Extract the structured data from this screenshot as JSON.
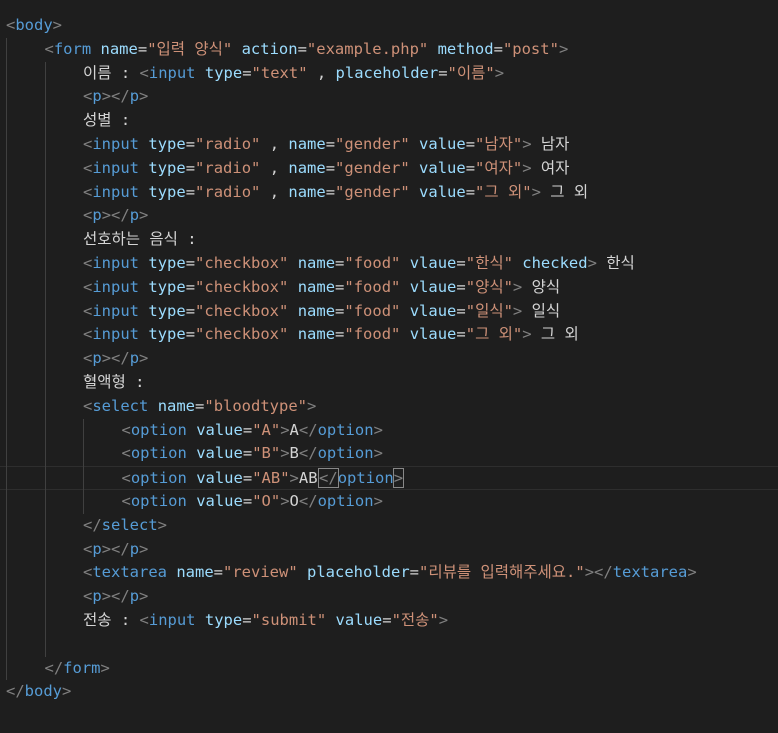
{
  "editor": {
    "language": "html",
    "colors": {
      "background": "#1e1e1e",
      "tag": "#569cd6",
      "punctuation": "#808080",
      "attribute": "#9cdcfe",
      "string": "#ce9178",
      "text": "#d4d4d4"
    },
    "current_line": 19,
    "lines": [
      {
        "indent": 0,
        "tokens": [
          [
            "p",
            "<"
          ],
          [
            "tag",
            "body"
          ],
          [
            "p",
            ">"
          ]
        ]
      },
      {
        "indent": 1,
        "tokens": [
          [
            "p",
            "<"
          ],
          [
            "tag",
            "form"
          ],
          [
            "t",
            " "
          ],
          [
            "attr",
            "name"
          ],
          [
            "e",
            "="
          ],
          [
            "str",
            "\"입력 양식\""
          ],
          [
            "t",
            " "
          ],
          [
            "attr",
            "action"
          ],
          [
            "e",
            "="
          ],
          [
            "str",
            "\"example.php\""
          ],
          [
            "t",
            " "
          ],
          [
            "attr",
            "method"
          ],
          [
            "e",
            "="
          ],
          [
            "str",
            "\"post\""
          ],
          [
            "p",
            ">"
          ]
        ]
      },
      {
        "indent": 2,
        "tokens": [
          [
            "t",
            "이름 : "
          ],
          [
            "p",
            "<"
          ],
          [
            "tag",
            "input"
          ],
          [
            "t",
            " "
          ],
          [
            "attr",
            "type"
          ],
          [
            "e",
            "="
          ],
          [
            "str",
            "\"text\""
          ],
          [
            "t",
            " , "
          ],
          [
            "attr",
            "placeholder"
          ],
          [
            "e",
            "="
          ],
          [
            "str",
            "\"이름\""
          ],
          [
            "p",
            ">"
          ]
        ]
      },
      {
        "indent": 2,
        "tokens": [
          [
            "p",
            "<"
          ],
          [
            "tag",
            "p"
          ],
          [
            "p",
            "></"
          ],
          [
            "tag",
            "p"
          ],
          [
            "p",
            ">"
          ]
        ]
      },
      {
        "indent": 2,
        "tokens": [
          [
            "t",
            "성별 :"
          ]
        ]
      },
      {
        "indent": 2,
        "tokens": [
          [
            "p",
            "<"
          ],
          [
            "tag",
            "input"
          ],
          [
            "t",
            " "
          ],
          [
            "attr",
            "type"
          ],
          [
            "e",
            "="
          ],
          [
            "str",
            "\"radio\""
          ],
          [
            "t",
            " , "
          ],
          [
            "attr",
            "name"
          ],
          [
            "e",
            "="
          ],
          [
            "str",
            "\"gender\""
          ],
          [
            "t",
            " "
          ],
          [
            "attr",
            "value"
          ],
          [
            "e",
            "="
          ],
          [
            "str",
            "\"남자\""
          ],
          [
            "p",
            ">"
          ],
          [
            "t",
            " 남자"
          ]
        ]
      },
      {
        "indent": 2,
        "tokens": [
          [
            "p",
            "<"
          ],
          [
            "tag",
            "input"
          ],
          [
            "t",
            " "
          ],
          [
            "attr",
            "type"
          ],
          [
            "e",
            "="
          ],
          [
            "str",
            "\"radio\""
          ],
          [
            "t",
            " , "
          ],
          [
            "attr",
            "name"
          ],
          [
            "e",
            "="
          ],
          [
            "str",
            "\"gender\""
          ],
          [
            "t",
            " "
          ],
          [
            "attr",
            "value"
          ],
          [
            "e",
            "="
          ],
          [
            "str",
            "\"여자\""
          ],
          [
            "p",
            ">"
          ],
          [
            "t",
            " 여자"
          ]
        ]
      },
      {
        "indent": 2,
        "tokens": [
          [
            "p",
            "<"
          ],
          [
            "tag",
            "input"
          ],
          [
            "t",
            " "
          ],
          [
            "attr",
            "type"
          ],
          [
            "e",
            "="
          ],
          [
            "str",
            "\"radio\""
          ],
          [
            "t",
            " , "
          ],
          [
            "attr",
            "name"
          ],
          [
            "e",
            "="
          ],
          [
            "str",
            "\"gender\""
          ],
          [
            "t",
            " "
          ],
          [
            "attr",
            "value"
          ],
          [
            "e",
            "="
          ],
          [
            "str",
            "\"그 외\""
          ],
          [
            "p",
            ">"
          ],
          [
            "t",
            " 그 외"
          ]
        ]
      },
      {
        "indent": 2,
        "tokens": [
          [
            "p",
            "<"
          ],
          [
            "tag",
            "p"
          ],
          [
            "p",
            "></"
          ],
          [
            "tag",
            "p"
          ],
          [
            "p",
            ">"
          ]
        ]
      },
      {
        "indent": 2,
        "tokens": [
          [
            "t",
            "선호하는 음식 :"
          ]
        ]
      },
      {
        "indent": 2,
        "tokens": [
          [
            "p",
            "<"
          ],
          [
            "tag",
            "input"
          ],
          [
            "t",
            " "
          ],
          [
            "attr",
            "type"
          ],
          [
            "e",
            "="
          ],
          [
            "str",
            "\"checkbox\""
          ],
          [
            "t",
            " "
          ],
          [
            "attr",
            "name"
          ],
          [
            "e",
            "="
          ],
          [
            "str",
            "\"food\""
          ],
          [
            "t",
            " "
          ],
          [
            "attr",
            "vlaue"
          ],
          [
            "e",
            "="
          ],
          [
            "str",
            "\"한식\""
          ],
          [
            "t",
            " "
          ],
          [
            "attr",
            "checked"
          ],
          [
            "p",
            ">"
          ],
          [
            "t",
            " 한식"
          ]
        ]
      },
      {
        "indent": 2,
        "tokens": [
          [
            "p",
            "<"
          ],
          [
            "tag",
            "input"
          ],
          [
            "t",
            " "
          ],
          [
            "attr",
            "type"
          ],
          [
            "e",
            "="
          ],
          [
            "str",
            "\"checkbox\""
          ],
          [
            "t",
            " "
          ],
          [
            "attr",
            "name"
          ],
          [
            "e",
            "="
          ],
          [
            "str",
            "\"food\""
          ],
          [
            "t",
            " "
          ],
          [
            "attr",
            "vlaue"
          ],
          [
            "e",
            "="
          ],
          [
            "str",
            "\"양식\""
          ],
          [
            "p",
            ">"
          ],
          [
            "t",
            " 양식"
          ]
        ]
      },
      {
        "indent": 2,
        "tokens": [
          [
            "p",
            "<"
          ],
          [
            "tag",
            "input"
          ],
          [
            "t",
            " "
          ],
          [
            "attr",
            "type"
          ],
          [
            "e",
            "="
          ],
          [
            "str",
            "\"checkbox\""
          ],
          [
            "t",
            " "
          ],
          [
            "attr",
            "name"
          ],
          [
            "e",
            "="
          ],
          [
            "str",
            "\"food\""
          ],
          [
            "t",
            " "
          ],
          [
            "attr",
            "vlaue"
          ],
          [
            "e",
            "="
          ],
          [
            "str",
            "\"일식\""
          ],
          [
            "p",
            ">"
          ],
          [
            "t",
            " 일식"
          ]
        ]
      },
      {
        "indent": 2,
        "tokens": [
          [
            "p",
            "<"
          ],
          [
            "tag",
            "input"
          ],
          [
            "t",
            " "
          ],
          [
            "attr",
            "type"
          ],
          [
            "e",
            "="
          ],
          [
            "str",
            "\"checkbox\""
          ],
          [
            "t",
            " "
          ],
          [
            "attr",
            "name"
          ],
          [
            "e",
            "="
          ],
          [
            "str",
            "\"food\""
          ],
          [
            "t",
            " "
          ],
          [
            "attr",
            "vlaue"
          ],
          [
            "e",
            "="
          ],
          [
            "str",
            "\"그 외\""
          ],
          [
            "p",
            ">"
          ],
          [
            "t",
            " 그 외"
          ]
        ]
      },
      {
        "indent": 2,
        "tokens": [
          [
            "p",
            "<"
          ],
          [
            "tag",
            "p"
          ],
          [
            "p",
            "></"
          ],
          [
            "tag",
            "p"
          ],
          [
            "p",
            ">"
          ]
        ]
      },
      {
        "indent": 2,
        "tokens": [
          [
            "t",
            "혈액형 :"
          ]
        ]
      },
      {
        "indent": 2,
        "tokens": [
          [
            "p",
            "<"
          ],
          [
            "tag",
            "select"
          ],
          [
            "t",
            " "
          ],
          [
            "attr",
            "name"
          ],
          [
            "e",
            "="
          ],
          [
            "str",
            "\"bloodtype\""
          ],
          [
            "p",
            ">"
          ]
        ]
      },
      {
        "indent": 3,
        "tokens": [
          [
            "p",
            "<"
          ],
          [
            "tag",
            "option"
          ],
          [
            "t",
            " "
          ],
          [
            "attr",
            "value"
          ],
          [
            "e",
            "="
          ],
          [
            "str",
            "\"A\""
          ],
          [
            "p",
            ">"
          ],
          [
            "t",
            "A"
          ],
          [
            "p",
            "</"
          ],
          [
            "tag",
            "option"
          ],
          [
            "p",
            ">"
          ]
        ]
      },
      {
        "indent": 3,
        "tokens": [
          [
            "p",
            "<"
          ],
          [
            "tag",
            "option"
          ],
          [
            "t",
            " "
          ],
          [
            "attr",
            "value"
          ],
          [
            "e",
            "="
          ],
          [
            "str",
            "\"B\""
          ],
          [
            "p",
            ">"
          ],
          [
            "t",
            "B"
          ],
          [
            "p",
            "</"
          ],
          [
            "tag",
            "option"
          ],
          [
            "p",
            ">"
          ]
        ]
      },
      {
        "indent": 3,
        "tokens": [
          [
            "p",
            "<"
          ],
          [
            "tag",
            "option"
          ],
          [
            "t",
            " "
          ],
          [
            "attr",
            "value"
          ],
          [
            "e",
            "="
          ],
          [
            "str",
            "\"AB\""
          ],
          [
            "p",
            ">"
          ],
          [
            "t",
            "AB"
          ],
          [
            "cursor",
            ""
          ],
          [
            "pm",
            "</"
          ],
          [
            "tag",
            "option"
          ],
          [
            "pm",
            ">"
          ]
        ]
      },
      {
        "indent": 3,
        "tokens": [
          [
            "p",
            "<"
          ],
          [
            "tag",
            "option"
          ],
          [
            "t",
            " "
          ],
          [
            "attr",
            "value"
          ],
          [
            "e",
            "="
          ],
          [
            "str",
            "\"O\""
          ],
          [
            "p",
            ">"
          ],
          [
            "t",
            "O"
          ],
          [
            "p",
            "</"
          ],
          [
            "tag",
            "option"
          ],
          [
            "p",
            ">"
          ]
        ]
      },
      {
        "indent": 2,
        "tokens": [
          [
            "p",
            "</"
          ],
          [
            "tag",
            "select"
          ],
          [
            "p",
            ">"
          ]
        ]
      },
      {
        "indent": 2,
        "tokens": [
          [
            "p",
            "<"
          ],
          [
            "tag",
            "p"
          ],
          [
            "p",
            "></"
          ],
          [
            "tag",
            "p"
          ],
          [
            "p",
            ">"
          ]
        ]
      },
      {
        "indent": 2,
        "tokens": [
          [
            "p",
            "<"
          ],
          [
            "tag",
            "textarea"
          ],
          [
            "t",
            " "
          ],
          [
            "attr",
            "name"
          ],
          [
            "e",
            "="
          ],
          [
            "str",
            "\"review\""
          ],
          [
            "t",
            " "
          ],
          [
            "attr",
            "placeholder"
          ],
          [
            "e",
            "="
          ],
          [
            "str",
            "\"리뷰를 입력해주세요.\""
          ],
          [
            "p",
            "></"
          ],
          [
            "tag",
            "textarea"
          ],
          [
            "p",
            ">"
          ]
        ]
      },
      {
        "indent": 2,
        "tokens": [
          [
            "p",
            "<"
          ],
          [
            "tag",
            "p"
          ],
          [
            "p",
            "></"
          ],
          [
            "tag",
            "p"
          ],
          [
            "p",
            ">"
          ]
        ]
      },
      {
        "indent": 2,
        "tokens": [
          [
            "t",
            "전송 : "
          ],
          [
            "p",
            "<"
          ],
          [
            "tag",
            "input"
          ],
          [
            "t",
            " "
          ],
          [
            "attr",
            "type"
          ],
          [
            "e",
            "="
          ],
          [
            "str",
            "\"submit\""
          ],
          [
            "t",
            " "
          ],
          [
            "attr",
            "value"
          ],
          [
            "e",
            "="
          ],
          [
            "str",
            "\"전송\""
          ],
          [
            "p",
            ">"
          ]
        ]
      },
      {
        "indent": 1,
        "tokens": []
      },
      {
        "indent": 1,
        "tokens": [
          [
            "p",
            "</"
          ],
          [
            "tag",
            "form"
          ],
          [
            "p",
            ">"
          ]
        ]
      },
      {
        "indent": 0,
        "tokens": [
          [
            "p",
            "</"
          ],
          [
            "tag",
            "body"
          ],
          [
            "p",
            ">"
          ]
        ]
      }
    ]
  }
}
